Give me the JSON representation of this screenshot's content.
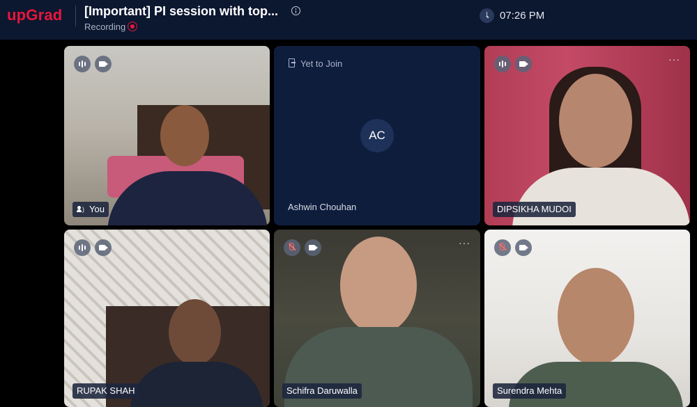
{
  "header": {
    "logo": "upGrad",
    "title": "[Important] PI session with top...",
    "status": "Recording",
    "time": "07:26 PM"
  },
  "participants": [
    {
      "name": "You",
      "mic": "active",
      "camera": "on",
      "self": true
    },
    {
      "name": "Ashwin Chouhan",
      "initials": "AC",
      "status": "Yet to Join"
    },
    {
      "name": "DIPSIKHA MUDOI",
      "mic": "active",
      "camera": "on"
    },
    {
      "name": "RUPAK SHAH",
      "mic": "active",
      "camera": "on"
    },
    {
      "name": "Schifra Daruwalla",
      "mic": "muted",
      "camera": "on"
    },
    {
      "name": "Surendra Mehta",
      "mic": "muted",
      "camera": "on"
    }
  ],
  "colors": {
    "brand": "#e8173a",
    "topbar_bg": "#0c1730",
    "tile_waiting_bg": "#0f1d3d"
  },
  "more_glyph": "···"
}
